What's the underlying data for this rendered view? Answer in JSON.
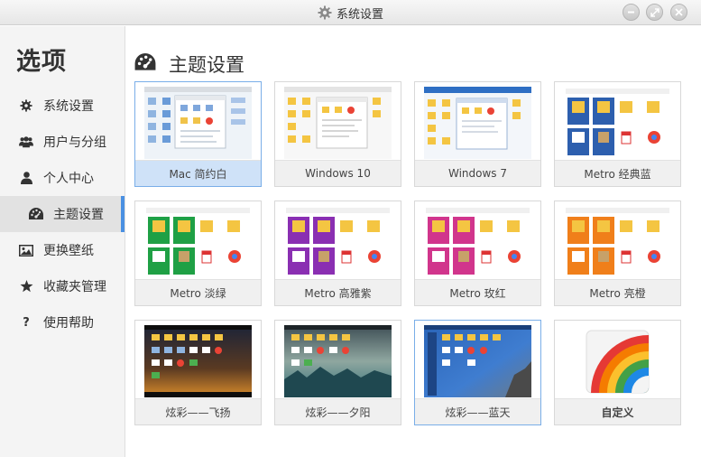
{
  "window": {
    "title": "系统设置",
    "icons": [
      "gear-icon",
      "minimize-icon",
      "maximize-icon",
      "close-icon"
    ]
  },
  "sidebar": {
    "title": "选项",
    "items": [
      {
        "label": "系统设置",
        "icon": "gear-icon"
      },
      {
        "label": "用户与分组",
        "icon": "users-icon"
      },
      {
        "label": "个人中心",
        "icon": "user-icon"
      },
      {
        "label": "主题设置",
        "icon": "palette-icon",
        "active": true
      },
      {
        "label": "更换壁纸",
        "icon": "image-icon"
      },
      {
        "label": "收藏夹管理",
        "icon": "star-icon"
      },
      {
        "label": "使用帮助",
        "icon": "question-icon"
      }
    ]
  },
  "main": {
    "title": "主题设置",
    "themes": [
      {
        "label": "Mac 简约白",
        "selected": true
      },
      {
        "label": "Windows 10"
      },
      {
        "label": "Windows 7"
      },
      {
        "label": "Metro 经典蓝"
      },
      {
        "label": "Metro 淡绿"
      },
      {
        "label": "Metro 高雅紫"
      },
      {
        "label": "Metro 玫红"
      },
      {
        "label": "Metro 亮橙"
      },
      {
        "label": "炫彩——飞扬"
      },
      {
        "label": "炫彩——夕阳"
      },
      {
        "label": "炫彩——蓝天"
      },
      {
        "label": "自定义"
      }
    ]
  },
  "colors": {
    "accent": "#4a90e2",
    "metro_blue": "#2d5fae",
    "metro_green": "#1fa045",
    "metro_purple": "#8a2fb2",
    "metro_rose": "#d1358c",
    "metro_orange": "#f07f1a"
  }
}
